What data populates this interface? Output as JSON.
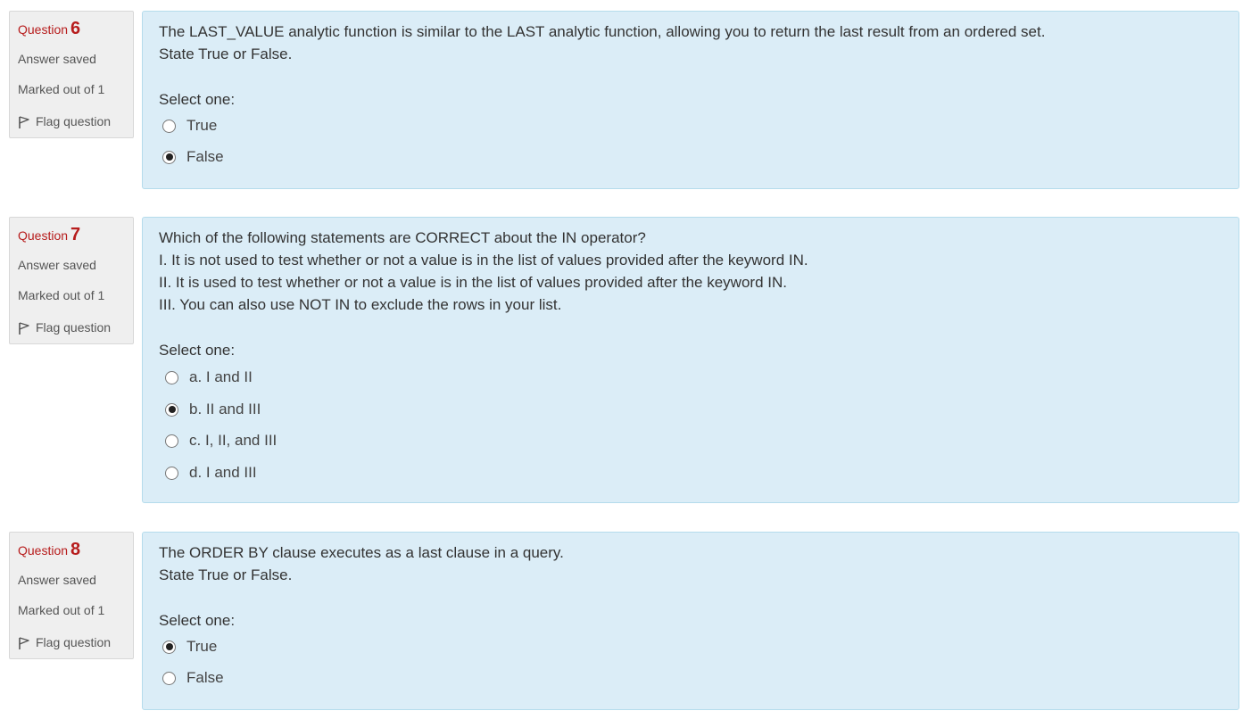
{
  "info_labels": {
    "question_word": "Question",
    "state": "Answer saved",
    "grade": "Marked out of 1",
    "flag": "Flag question"
  },
  "prompt_label": "Select one:",
  "questions": [
    {
      "number": "6",
      "text": [
        "The LAST_VALUE analytic function is similar to the LAST analytic function, allowing you to return the last result from an ordered set.",
        "State True or False."
      ],
      "options": [
        {
          "label": "True",
          "checked": false
        },
        {
          "label": "False",
          "checked": true
        }
      ]
    },
    {
      "number": "7",
      "text": [
        "Which of the following statements are CORRECT about the IN operator?",
        "I. It is not used to test whether or not a value is in the list of values provided after the keyword IN.",
        "II. It is used to test whether or not a value is in the list of values provided after the keyword IN.",
        "III. You can also use NOT IN to exclude the rows in your list."
      ],
      "options": [
        {
          "label": "a. I and II",
          "checked": false
        },
        {
          "label": "b. II and III",
          "checked": true
        },
        {
          "label": "c. I, II, and III",
          "checked": false
        },
        {
          "label": "d. I and III",
          "checked": false
        }
      ]
    },
    {
      "number": "8",
      "text": [
        "The ORDER BY clause executes as a last clause in a query.",
        "State True or False."
      ],
      "options": [
        {
          "label": "True",
          "checked": true
        },
        {
          "label": "False",
          "checked": false
        }
      ]
    }
  ]
}
